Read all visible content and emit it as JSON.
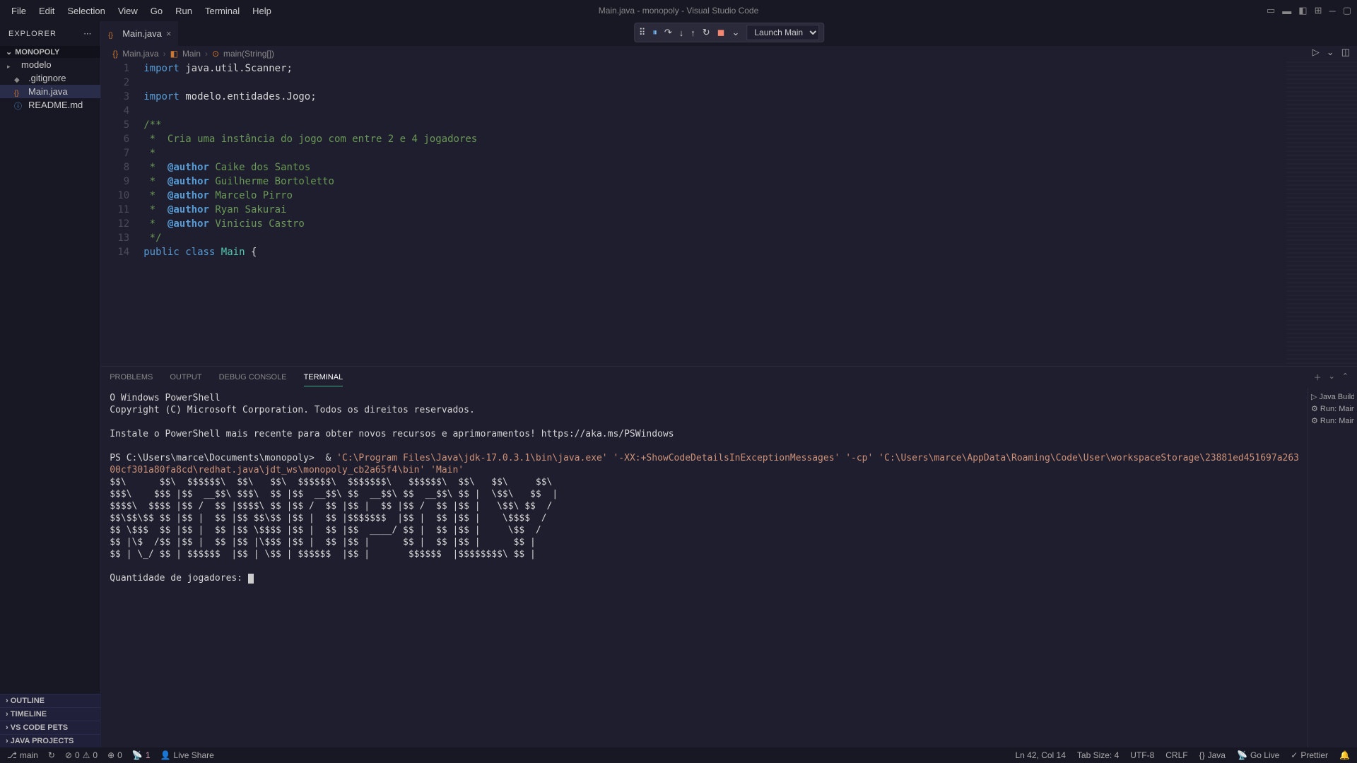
{
  "window": {
    "title": "Main.java - monopoly - Visual Studio Code"
  },
  "menu": [
    "File",
    "Edit",
    "Selection",
    "View",
    "Go",
    "Run",
    "Terminal",
    "Help"
  ],
  "explorer": {
    "title": "EXPLORER",
    "root": "MONOPOLY",
    "items": [
      {
        "label": "modelo",
        "type": "folder"
      },
      {
        "label": ".gitignore",
        "type": "git"
      },
      {
        "label": "Main.java",
        "type": "java",
        "selected": true
      },
      {
        "label": "README.md",
        "type": "md"
      }
    ],
    "sections": [
      "OUTLINE",
      "TIMELINE",
      "VS CODE PETS",
      "JAVA PROJECTS"
    ]
  },
  "tabs": [
    {
      "label": "Main.java",
      "icon": "java"
    }
  ],
  "breadcrumb": [
    {
      "text": "Main.java",
      "sym": "{}"
    },
    {
      "text": "Main",
      "sym": "◧"
    },
    {
      "text": "main(String[])",
      "sym": "⊙"
    }
  ],
  "editor": {
    "lines": [
      {
        "n": 1,
        "tokens": [
          [
            "kw",
            "import"
          ],
          [
            "pkg",
            " java.util.Scanner;"
          ]
        ]
      },
      {
        "n": 2,
        "tokens": []
      },
      {
        "n": 3,
        "tokens": [
          [
            "kw",
            "import"
          ],
          [
            "pkg",
            " modelo.entidades.Jogo;"
          ]
        ]
      },
      {
        "n": 4,
        "tokens": []
      },
      {
        "n": 5,
        "tokens": [
          [
            "doc",
            "/**"
          ]
        ]
      },
      {
        "n": 6,
        "tokens": [
          [
            "doc",
            " *  Cria uma instância do jogo com entre 2 e 4 jogadores"
          ]
        ]
      },
      {
        "n": 7,
        "tokens": [
          [
            "doc",
            " *"
          ]
        ]
      },
      {
        "n": 8,
        "tokens": [
          [
            "doc",
            " *  "
          ],
          [
            "ann",
            "@author"
          ],
          [
            "doc",
            " Caike dos Santos"
          ]
        ]
      },
      {
        "n": 9,
        "tokens": [
          [
            "doc",
            " *  "
          ],
          [
            "ann",
            "@author"
          ],
          [
            "doc",
            " Guilherme Bortoletto"
          ]
        ]
      },
      {
        "n": 10,
        "tokens": [
          [
            "doc",
            " *  "
          ],
          [
            "ann",
            "@author"
          ],
          [
            "doc",
            " Marcelo Pirro"
          ]
        ]
      },
      {
        "n": 11,
        "tokens": [
          [
            "doc",
            " *  "
          ],
          [
            "ann",
            "@author"
          ],
          [
            "doc",
            " Ryan Sakurai"
          ]
        ]
      },
      {
        "n": 12,
        "tokens": [
          [
            "doc",
            " *  "
          ],
          [
            "ann",
            "@author"
          ],
          [
            "doc",
            " Vinicius Castro"
          ]
        ]
      },
      {
        "n": 13,
        "tokens": [
          [
            "doc",
            " */"
          ]
        ]
      },
      {
        "n": 14,
        "tokens": [
          [
            "kw",
            "public class "
          ],
          [
            "cls",
            "Main"
          ],
          [
            "pkg",
            " {"
          ]
        ]
      }
    ]
  },
  "debug": {
    "config": "Launch Main"
  },
  "panel": {
    "tabs": [
      "PROBLEMS",
      "OUTPUT",
      "DEBUG CONSOLE",
      "TERMINAL"
    ],
    "active": 3,
    "terminals": [
      "Java Build",
      "Run: Main",
      "Run: Main"
    ]
  },
  "terminal": {
    "lines": [
      "O Windows PowerShell",
      "Copyright (C) Microsoft Corporation. Todos os direitos reservados.",
      "",
      "Instale o PowerShell mais recente para obter novos recursos e aprimoramentos! https://aka.ms/PSWindows",
      ""
    ],
    "prompt_prefix": "PS C:\\Users\\marce\\Documents\\monopoly>  ",
    "cmd_amp": "& ",
    "cmd_paths": [
      "'C:\\Program Files\\Java\\jdk-17.0.3.1\\bin\\java.exe'",
      " '-XX:+ShowCodeDetailsInExceptionMessages'",
      " '-cp'",
      " 'C:\\Users\\marce\\AppData\\Roaming\\Code\\User\\workspaceStorage\\23881ed451697a263"
    ],
    "cmd_line2": "00cf301a80fa8cd\\redhat.java\\jdt_ws\\monopoly_cb2a65f4\\bin' 'Main'",
    "ascii": [
      "$$\\      $$\\  $$$$$$\\  $$\\   $$\\  $$$$$$\\  $$$$$$$\\   $$$$$$\\  $$\\   $$\\     $$\\",
      "$$$\\    $$$ |$$  __$$\\ $$$\\  $$ |$$  __$$\\ $$  __$$\\ $$  __$$\\ $$ |  \\$$\\   $$  |",
      "$$$$\\  $$$$ |$$ /  $$ |$$$$\\ $$ |$$ /  $$ |$$ |  $$ |$$ /  $$ |$$ |   \\$$\\ $$  /",
      "$$\\$$\\$$ $$ |$$ |  $$ |$$ $$\\$$ |$$ |  $$ |$$$$$$$  |$$ |  $$ |$$ |    \\$$$$  /",
      "$$ \\$$$  $$ |$$ |  $$ |$$ \\$$$$ |$$ |  $$ |$$  ____/ $$ |  $$ |$$ |     \\$$  /",
      "$$ |\\$  /$$ |$$ |  $$ |$$ |\\$$$ |$$ |  $$ |$$ |      $$ |  $$ |$$ |      $$ |",
      "$$ | \\_/ $$ | $$$$$$  |$$ | \\$$ | $$$$$$  |$$ |       $$$$$$  |$$$$$$$$\\ $$ |"
    ],
    "prompt_q": "Quantidade de jogadores: "
  },
  "status": {
    "branch": "main",
    "sync": "↻",
    "errors": "0",
    "warnings": "0",
    "ports": "0",
    "radio": "1",
    "liveshare": "Live Share",
    "pos": "Ln 42, Col 14",
    "tabsize": "Tab Size: 4",
    "encoding": "UTF-8",
    "eol": "CRLF",
    "lang": "Java",
    "golive": "Go Live",
    "prettier": "Prettier"
  }
}
